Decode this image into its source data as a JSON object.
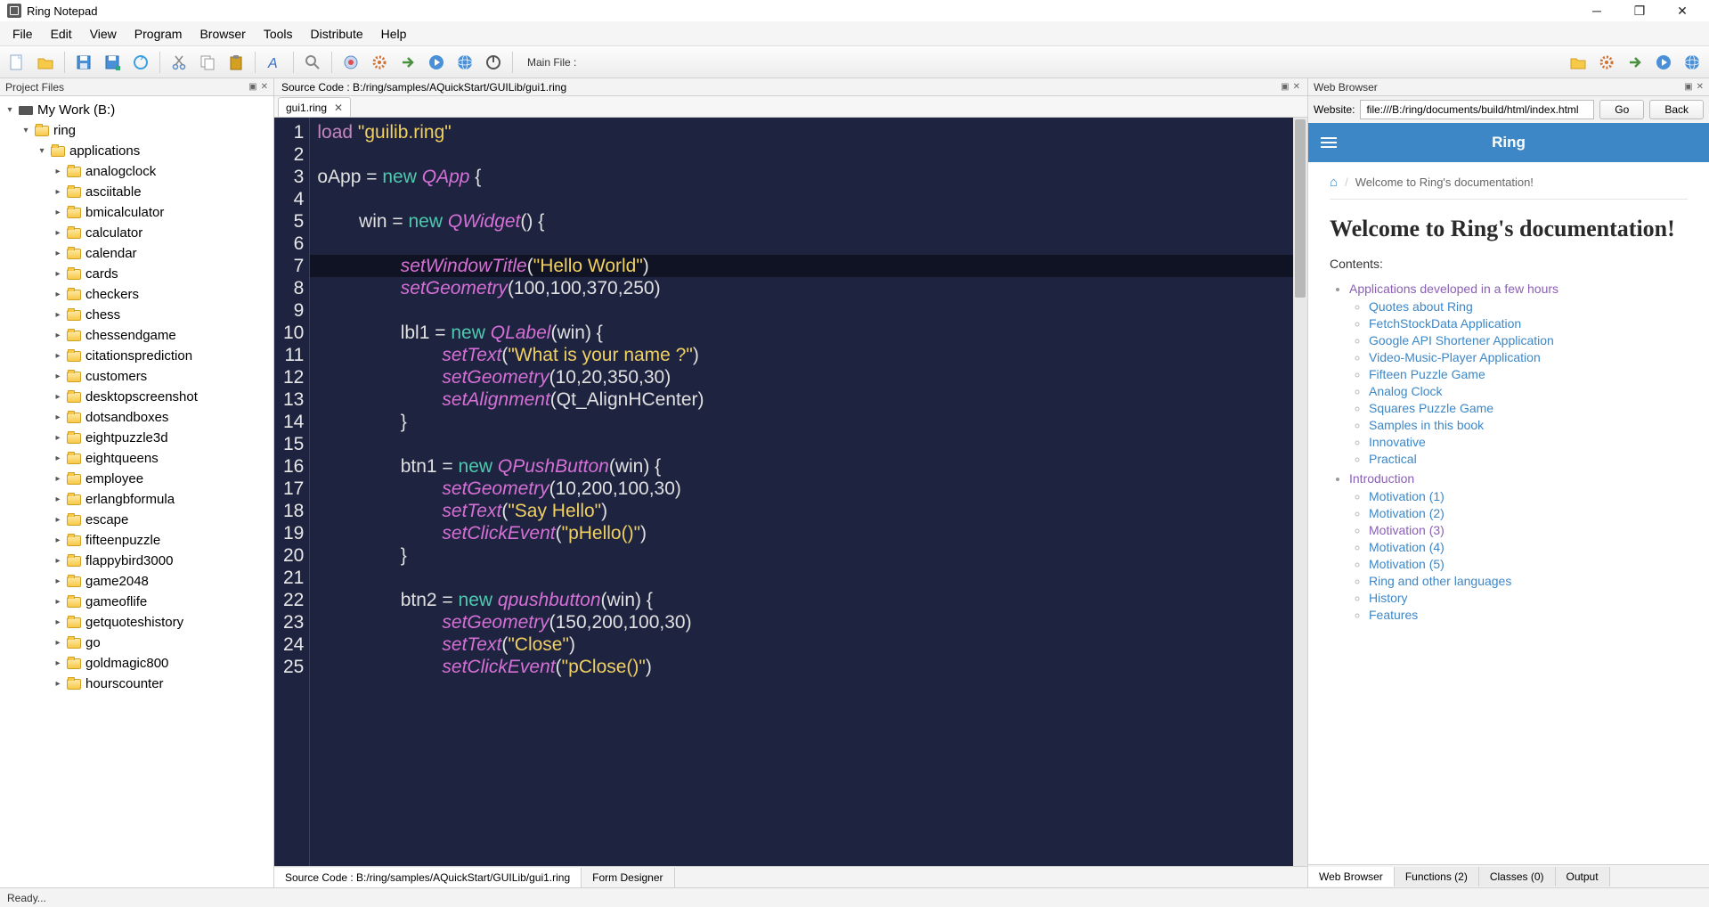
{
  "window": {
    "title": "Ring Notepad"
  },
  "menu": [
    "File",
    "Edit",
    "View",
    "Program",
    "Browser",
    "Tools",
    "Distribute",
    "Help"
  ],
  "toolbar": {
    "mainfile_label": "Main File :"
  },
  "project": {
    "title": "Project Files",
    "root": "My Work (B:)",
    "ring": "ring",
    "applications": "applications",
    "folders": [
      "analogclock",
      "asciitable",
      "bmicalculator",
      "calculator",
      "calendar",
      "cards",
      "checkers",
      "chess",
      "chessendgame",
      "citationsprediction",
      "customers",
      "desktopscreenshot",
      "dotsandboxes",
      "eightpuzzle3d",
      "eightqueens",
      "employee",
      "erlangbformula",
      "escape",
      "fifteenpuzzle",
      "flappybird3000",
      "game2048",
      "gameoflife",
      "getquoteshistory",
      "go",
      "goldmagic800",
      "hourscounter"
    ]
  },
  "source": {
    "header": "Source Code : B:/ring/samples/AQuickStart/GUILib/gui1.ring",
    "tab": "gui1.ring",
    "bottom_tabs": [
      "Source Code : B:/ring/samples/AQuickStart/GUILib/gui1.ring",
      "Form Designer"
    ]
  },
  "code_lines": 25,
  "browser": {
    "title": "Web Browser",
    "website_label": "Website:",
    "url": "file:///B:/ring/documents/build/html/index.html",
    "go": "Go",
    "back": "Back",
    "topbar_title": "Ring",
    "breadcrumb": "Welcome to Ring's documentation!",
    "h1": "Welcome to Ring's documentation!",
    "contents_label": "Contents:",
    "sections": [
      {
        "label": "Applications developed in a few hours",
        "visited": true,
        "items": [
          {
            "label": "Quotes about Ring"
          },
          {
            "label": "FetchStockData Application"
          },
          {
            "label": "Google API Shortener Application"
          },
          {
            "label": "Video-Music-Player Application"
          },
          {
            "label": "Fifteen Puzzle Game"
          },
          {
            "label": "Analog Clock"
          },
          {
            "label": "Squares Puzzle Game"
          },
          {
            "label": "Samples in this book"
          },
          {
            "label": "Innovative"
          },
          {
            "label": "Practical"
          }
        ]
      },
      {
        "label": "Introduction",
        "visited": true,
        "items": [
          {
            "label": "Motivation (1)"
          },
          {
            "label": "Motivation (2)"
          },
          {
            "label": "Motivation (3)",
            "visited": true
          },
          {
            "label": "Motivation (4)"
          },
          {
            "label": "Motivation (5)"
          },
          {
            "label": "Ring and other languages"
          },
          {
            "label": "History"
          },
          {
            "label": "Features"
          }
        ]
      }
    ],
    "tabs": [
      "Web Browser",
      "Functions (2)",
      "Classes (0)",
      "Output"
    ]
  },
  "status": "Ready..."
}
